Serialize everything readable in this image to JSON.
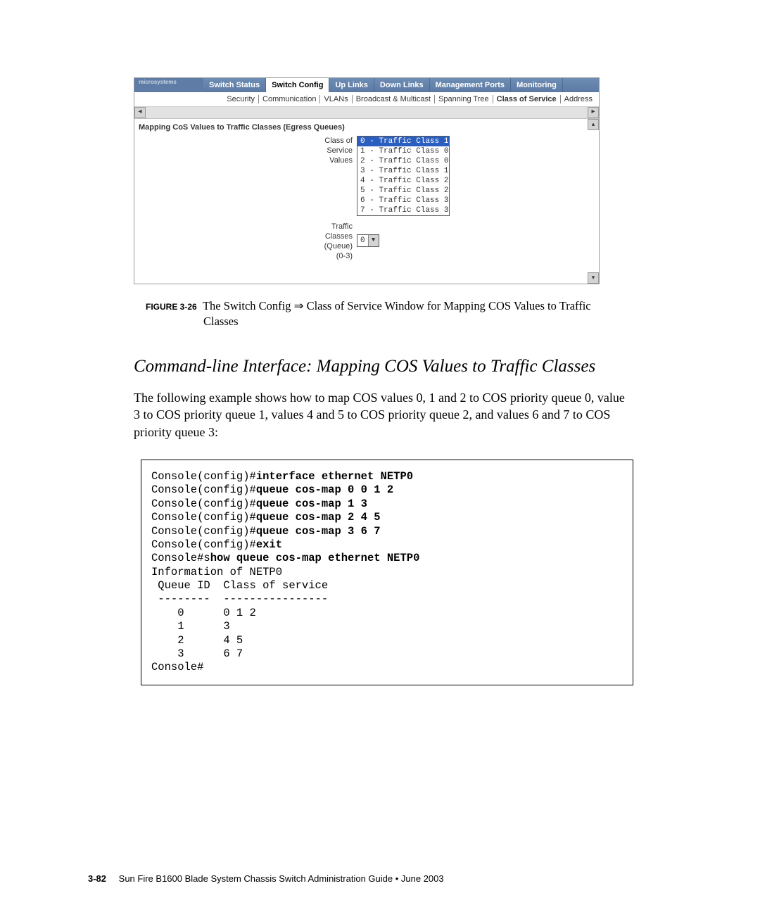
{
  "ui": {
    "logo": "microsystems",
    "tabs": [
      "Switch Status",
      "Switch Config",
      "Up Links",
      "Down Links",
      "Management Ports",
      "Monitoring"
    ],
    "subtabs": [
      "Security",
      "Communication",
      "VLANs",
      "Broadcast & Multicast",
      "Spanning Tree",
      "Class of Service",
      "Address"
    ],
    "panel_title": "Mapping CoS Values to Traffic Classes (Egress Queues)",
    "listbox_label_l1": "Class of",
    "listbox_label_l2": "Service",
    "listbox_label_l3": "Values",
    "cos": [
      "0 - Traffic Class 1",
      "1 - Traffic Class 0",
      "2 - Traffic Class 0",
      "3 - Traffic Class 1",
      "4 - Traffic Class 2",
      "5 - Traffic Class 2",
      "6 - Traffic Class 3",
      "7 - Traffic Class 3"
    ],
    "queue_label_l1": "Traffic",
    "queue_label_l2": "Classes",
    "queue_label_l3": "(Queue)",
    "queue_label_l4": "(0-3)",
    "queue_value": "0"
  },
  "caption": {
    "fignum": "FIGURE 3-26",
    "text_a": "The Switch Config ",
    "arrow": "⇒",
    "text_b": " Class of Service Window for Mapping COS Values to Traffic Classes"
  },
  "heading": "Command-line Interface: Mapping COS Values to Traffic Classes",
  "body": "The following example shows how to map COS values 0, 1 and 2 to COS priority queue 0, value 3 to COS priority queue 1, values 4 and 5 to COS priority queue 2, and values 6 and 7 to COS priority queue 3:",
  "console": {
    "p1": "Console(config)#",
    "c1": "interface ethernet NETP0",
    "p2": "Console(config)#",
    "c2": "queue cos-map 0 0 1 2",
    "p3": "Console(config)#",
    "c3": "queue cos-map 1 3",
    "p4": "Console(config)#",
    "c4": "queue cos-map 2 4 5",
    "p5": "Console(config)#",
    "c5": "queue cos-map 3 6 7",
    "p6": "Console(config)#",
    "c6": "exit",
    "p7": "Console#s",
    "c7": "how queue cos-map ethernet NETP0",
    "out": "Information of NETP0\n Queue ID  Class of service\n --------  ----------------\n    0      0 1 2\n    1      3\n    2      4 5\n    3      6 7\nConsole#"
  },
  "footer": {
    "pagenum": "3-82",
    "text": "Sun Fire B1600 Blade System Chassis Switch Administration Guide • June 2003"
  }
}
